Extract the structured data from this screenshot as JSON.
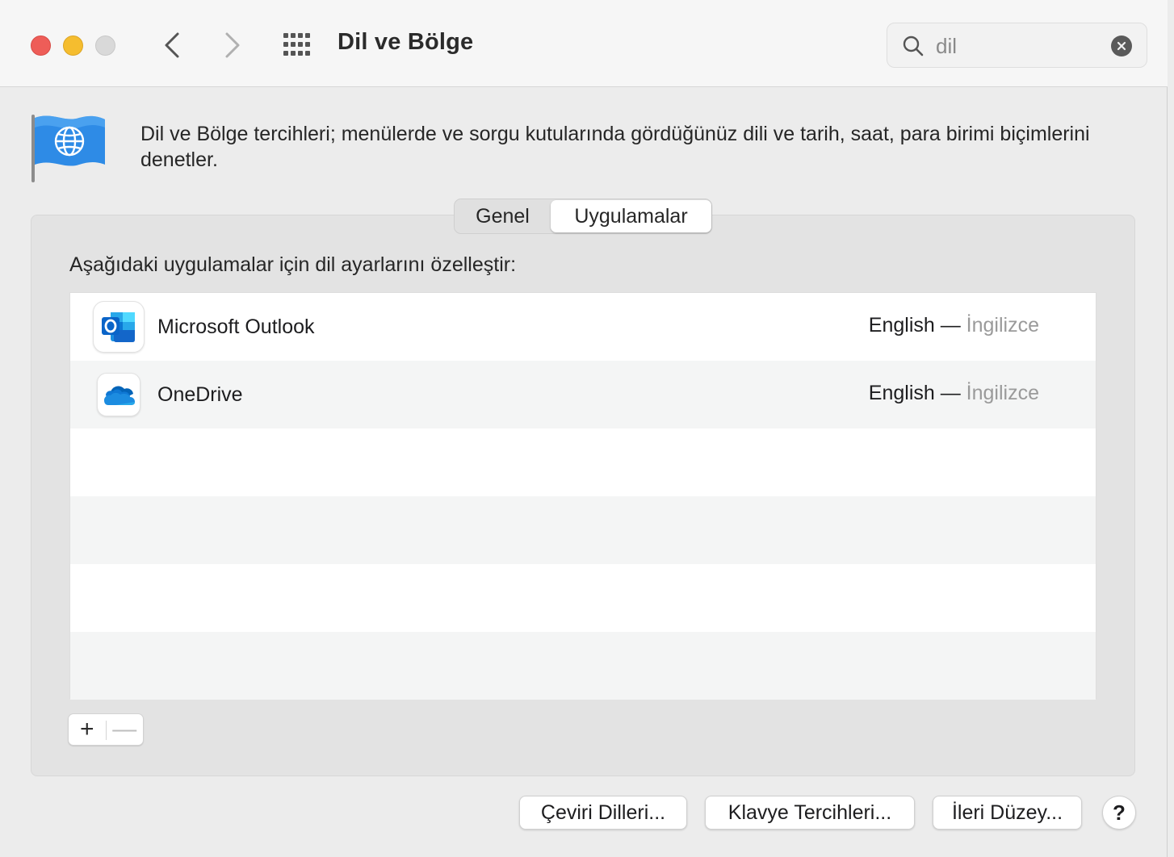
{
  "window": {
    "title": "Dil ve Bölge"
  },
  "search": {
    "value": "dil"
  },
  "header": {
    "description": "Dil ve Bölge tercihleri; menülerde ve sorgu kutularında gördüğünüz dili ve tarih, saat, para birimi biçimlerini denetler."
  },
  "tabs": [
    {
      "label": "Genel",
      "selected": false
    },
    {
      "label": "Uygulamalar",
      "selected": true
    }
  ],
  "apps_section": {
    "caption": "Aşağıdaki uygulamalar için dil ayarlarını özelleştir:",
    "apps": [
      {
        "name": "Microsoft Outlook",
        "language": "English — ",
        "language_native": "İngilizce",
        "icon": "outlook-icon"
      },
      {
        "name": "OneDrive",
        "language": "English — ",
        "language_native": "İngilizce",
        "icon": "onedrive-icon"
      }
    ],
    "add_label": "+",
    "remove_label": "—"
  },
  "buttons": {
    "translation_languages": "Çeviri Dilleri...",
    "keyboard_preferences": "Klavye Tercihleri...",
    "advanced": "İleri Düzey...",
    "help": "?"
  },
  "colors": {
    "close": "#ee5d58",
    "minimize": "#f5bd2f",
    "zoom_disabled": "#d9d9d9",
    "flag_blue": "#2e8be6",
    "outlook_blue": "#0a64c8",
    "onedrive_blue": "#1c8ce0"
  }
}
